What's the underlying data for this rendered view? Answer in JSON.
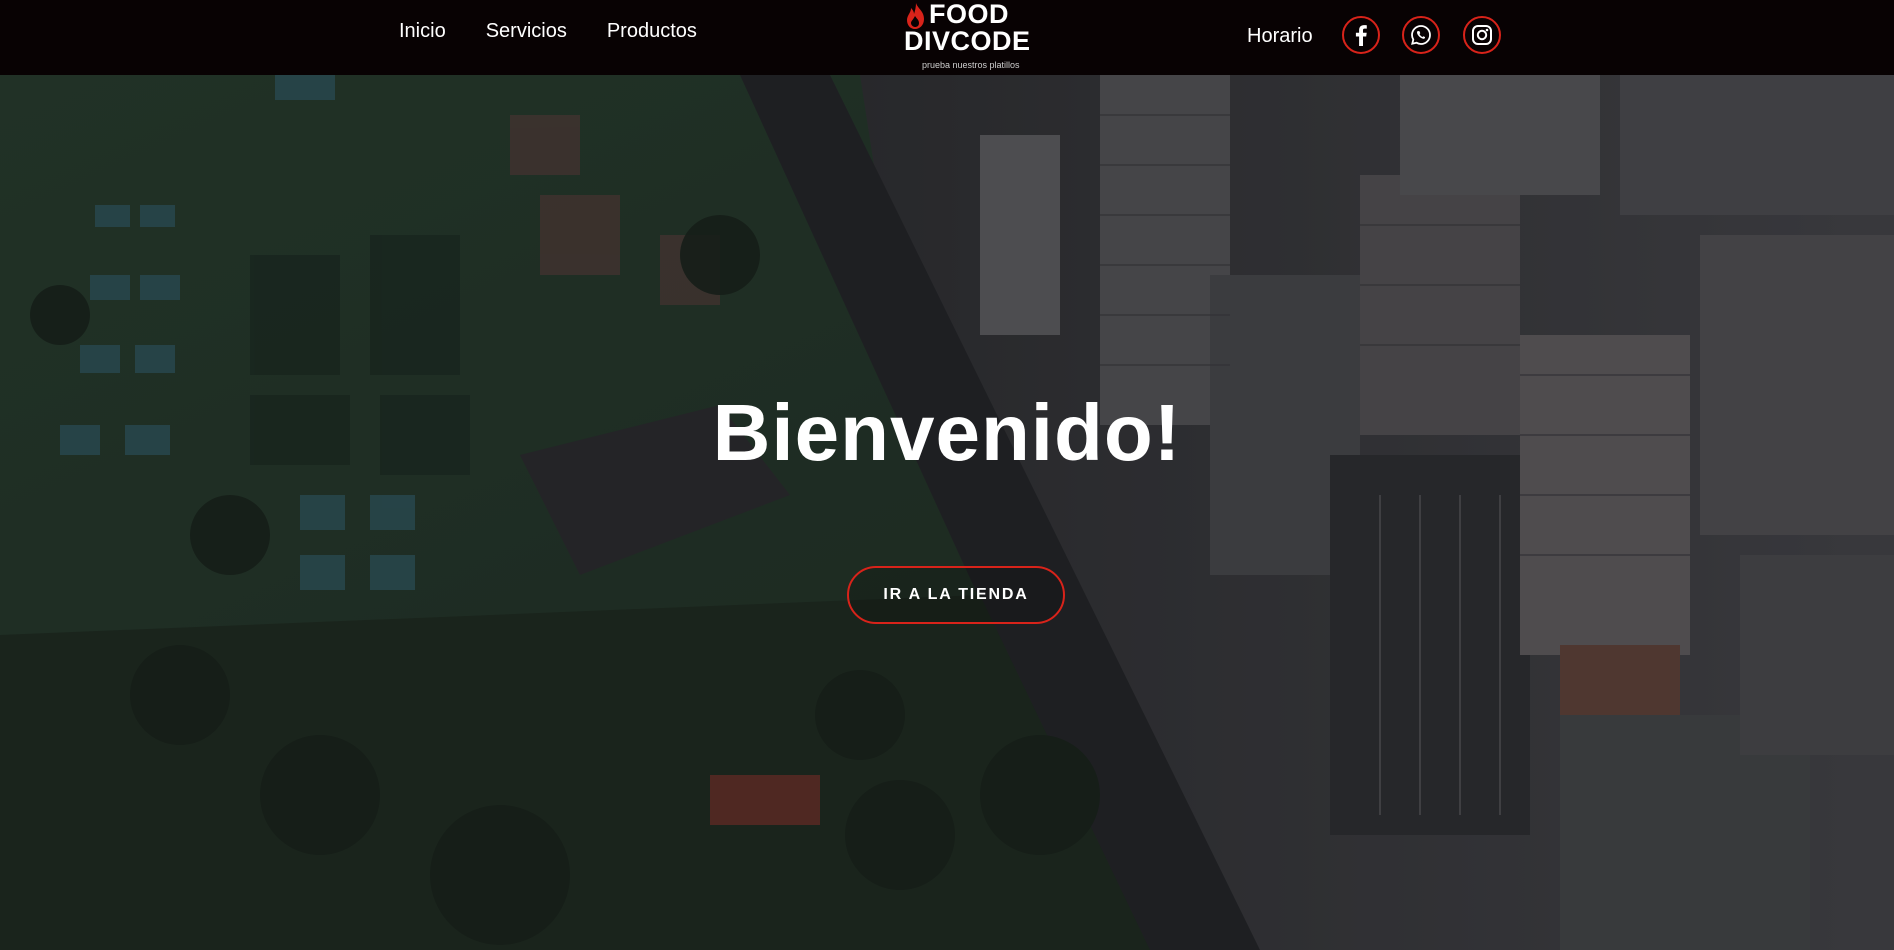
{
  "header": {
    "nav_left": [
      {
        "label": "Inicio"
      },
      {
        "label": "Servicios"
      },
      {
        "label": "Productos"
      }
    ],
    "nav_right_label": "Horario",
    "logo": {
      "line1": "FOOD",
      "line2": "DIVCODE",
      "tagline": "prueba nuestros platillos",
      "icon": "flame-icon"
    },
    "social": [
      {
        "icon": "facebook-icon"
      },
      {
        "icon": "whatsapp-icon"
      },
      {
        "icon": "instagram-icon"
      }
    ]
  },
  "hero": {
    "title": "Bienvenido!",
    "button_label": "IR A LA TIENDA"
  },
  "colors": {
    "accent": "#d8231a",
    "header_bg": "#080203",
    "text": "#ffffff"
  }
}
